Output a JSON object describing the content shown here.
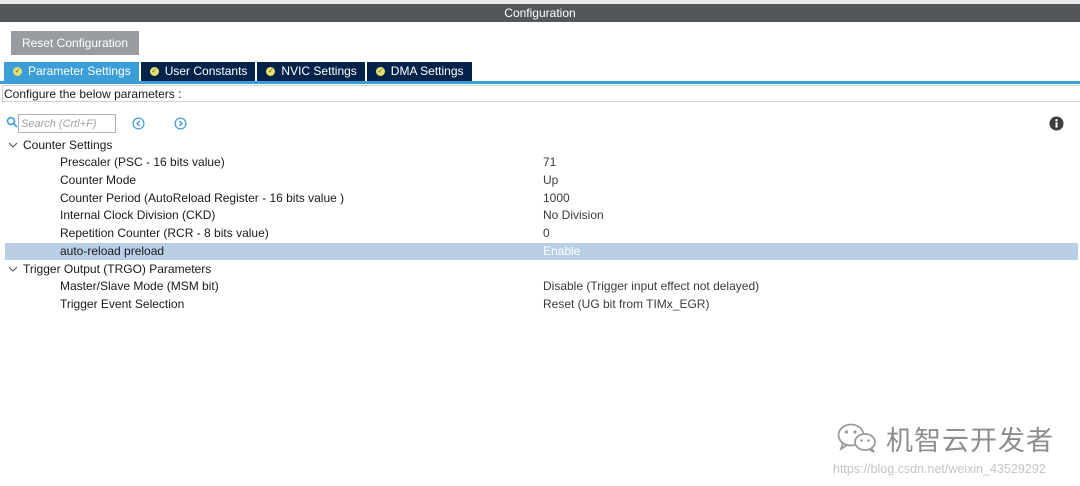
{
  "window": {
    "title": "Configuration"
  },
  "toolbar": {
    "reset_label": "Reset Configuration"
  },
  "tabs": [
    {
      "label": "Parameter Settings",
      "active": true
    },
    {
      "label": "User Constants",
      "active": false
    },
    {
      "label": "NVIC Settings",
      "active": false
    },
    {
      "label": "DMA Settings",
      "active": false
    }
  ],
  "configure_text": "Configure the below parameters :",
  "search": {
    "placeholder": "Search (Crtl+F)",
    "icon": "search-icon"
  },
  "groups": [
    {
      "label": "Counter Settings",
      "params": [
        {
          "name": "Prescaler (PSC - 16 bits value)",
          "value": "71"
        },
        {
          "name": "Counter Mode",
          "value": "Up"
        },
        {
          "name": "Counter Period (AutoReload Register - 16 bits value )",
          "value": "1000"
        },
        {
          "name": "Internal Clock Division (CKD)",
          "value": "No Division"
        },
        {
          "name": "Repetition Counter (RCR - 8 bits value)",
          "value": "0"
        },
        {
          "name": "auto-reload preload",
          "value": "Enable",
          "selected": true
        }
      ]
    },
    {
      "label": "Trigger Output (TRGO) Parameters",
      "params": [
        {
          "name": "Master/Slave Mode (MSM bit)",
          "value": "Disable (Trigger input effect not delayed)"
        },
        {
          "name": "Trigger Event Selection",
          "value": "Reset (UG bit from TIMx_EGR)"
        }
      ]
    }
  ],
  "watermark": {
    "text": "机智云开发者",
    "url": "https://blog.csdn.net/weixin_43529292"
  },
  "colors": {
    "accent": "#3c9ed8",
    "tab_bg": "#03234b",
    "title_bg": "#53575a",
    "selection": "#b8cfe6"
  }
}
